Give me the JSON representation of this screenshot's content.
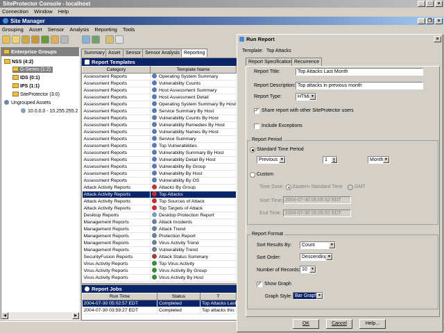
{
  "app": {
    "title": "SiteProtector Console - localhost",
    "menu": [
      "Connection",
      "Window",
      "Help"
    ]
  },
  "site_manager": {
    "title": "Site Manager",
    "menu": [
      "Grouping",
      "Asset",
      "Sensor",
      "Analysis",
      "Reporting",
      "Tools"
    ]
  },
  "tree": {
    "header": "Enterprise Groups",
    "items": [
      {
        "label": "NSS (4:2)",
        "bold": true
      },
      {
        "label": "G-Series (1:2)",
        "selected": true
      },
      {
        "label": "IDS (0:1)",
        "bold": true
      },
      {
        "label": "IPS (1:1)",
        "bold": true
      },
      {
        "label": "SiteProtector (3:0)"
      },
      {
        "label": "Ungrouped Assets"
      },
      {
        "label": "10.0.0.0 - 10.255.255.2"
      }
    ]
  },
  "tabs": [
    "Summary",
    "Asset",
    "Sensor",
    "Sensor Analysis",
    "Reporting"
  ],
  "report_templates": {
    "title": "Report Templates",
    "columns": [
      "Category",
      "Template Name"
    ],
    "rows": [
      [
        "Assessment Reports",
        "Operating System Summary"
      ],
      [
        "Assessment Reports",
        "Vulnerability Counts"
      ],
      [
        "Assessment Reports",
        "Host Assessment Summary"
      ],
      [
        "Assessment Reports",
        "Host Assessment Detail"
      ],
      [
        "Assessment Reports",
        "Operating System Summary By Host"
      ],
      [
        "Assessment Reports",
        "Service Summary By Host"
      ],
      [
        "Assessment Reports",
        "Vulnerability Counts By Host"
      ],
      [
        "Assessment Reports",
        "Vulnerability Remedies By Host"
      ],
      [
        "Assessment Reports",
        "Vulnerability Names By Host"
      ],
      [
        "Assessment Reports",
        "Service Summary"
      ],
      [
        "Assessment Reports",
        "Top Vulnerabilities"
      ],
      [
        "Assessment Reports",
        "Vulnerability Summary By Host"
      ],
      [
        "Assessment Reports",
        "Vulnerability Detail By Host"
      ],
      [
        "Assessment Reports",
        "Vulnerability By Group"
      ],
      [
        "Assessment Reports",
        "Vulnerability By Host"
      ],
      [
        "Assessment Reports",
        "Vulnerability By OS"
      ],
      [
        "Attack Activity Reports",
        "Attacks By Group"
      ],
      [
        "Attack Activity Reports",
        "Top Attacks"
      ],
      [
        "Attack Activity Reports",
        "Top Sources of Attack"
      ],
      [
        "Attack Activity Reports",
        "Top Targets of Attack"
      ],
      [
        "Desktop Reports",
        "Desktop Protection Report"
      ],
      [
        "Management Reports",
        "Attack Incidents"
      ],
      [
        "Management Reports",
        "Attack Trend"
      ],
      [
        "Management Reports",
        "Protection Report"
      ],
      [
        "Management Reports",
        "Virus Activity Trend"
      ],
      [
        "Management Reports",
        "Vulnerability Trend"
      ],
      [
        "SecurityFusion Reports",
        "Attack Status Summary"
      ],
      [
        "Virus Activity Reports",
        "Top Virus Activity"
      ],
      [
        "Virus Activity Reports",
        "Virus Activity By Group"
      ],
      [
        "Virus Activity Reports",
        "Virus Activity By Host"
      ]
    ]
  },
  "report_jobs": {
    "title": "Report Jobs",
    "columns": [
      "Run Time",
      "Status",
      "T"
    ],
    "rows": [
      [
        "2004-07-30 05:02:57 EDT",
        "Completed",
        "Top Attacks Last"
      ],
      [
        "2004-07-30 03:59:27 EDT",
        "Completed",
        "Top attacks this"
      ]
    ]
  },
  "dialog": {
    "title": "Run Report",
    "template_label": "Template:",
    "template_value": "Top Attacks",
    "tabs": [
      "Report Specification",
      "Recurrence"
    ],
    "report_title_label": "Report Title:",
    "report_title_value": "Top Attacks Last  Month",
    "report_desc_label": "Report Description:",
    "report_desc_value": "Top attacks in previous month",
    "report_type_label": "Report Type:",
    "report_type_value": "HTML",
    "share_label": "Share report with other SiteProtector users",
    "include_exceptions_label": "Include Exceptions",
    "period_group": "Report Period",
    "standard_label": "Standard Time Period",
    "period_direction": "Previous",
    "period_count": "1",
    "period_unit": "Month",
    "custom_label": "Custom",
    "timezone_label": "Time Zone:",
    "tz_eastern": "Eastern Standard Time",
    "tz_gmt": "GMT",
    "start_label": "Start Time:",
    "start_value": "2004-07-30 05:05:52 EDT",
    "end_label": "End Time:",
    "end_value": "2004-07-30 05:05:52 EDT",
    "format_group": "Report Format",
    "sort_by_label": "Sort Results By:",
    "sort_by_value": "Count",
    "sort_order_label": "Sort Order:",
    "sort_order_value": "Descending",
    "num_records_label": "Number of Records:",
    "num_records_value": "10",
    "show_graph_label": "Show Graph",
    "graph_style_label": "Graph Style:",
    "graph_style_value": "Bar Graph",
    "ok": "OK",
    "cancel": "Cancel",
    "help": "Help..."
  }
}
